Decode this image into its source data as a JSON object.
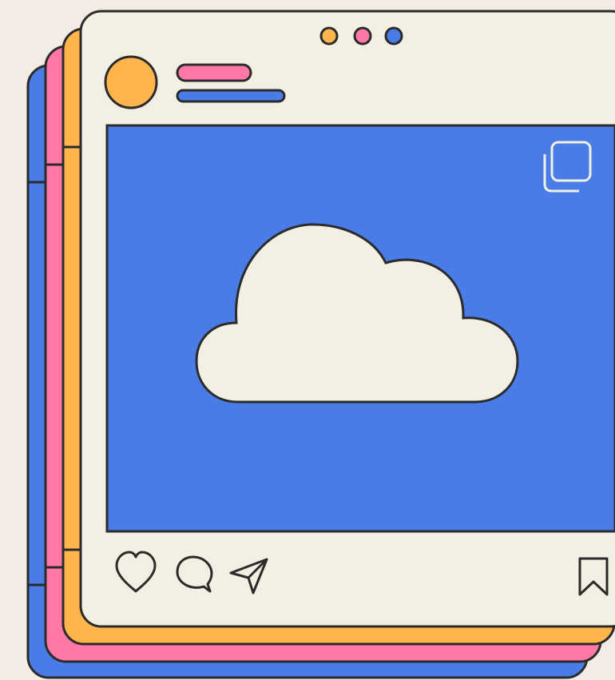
{
  "post": {
    "window_dots": [
      {
        "name": "dot-orange",
        "color": "#FFB54C"
      },
      {
        "name": "dot-pink",
        "color": "#FF78A8"
      },
      {
        "name": "dot-blue",
        "color": "#4A7CE8"
      }
    ],
    "avatar_icon": "avatar-circle",
    "username_placeholder_lines": [
      "pink-line",
      "blue-line"
    ],
    "media": {
      "icon": "cloud-icon",
      "corner_icon": "multiple-images-icon"
    },
    "actions": [
      {
        "name": "like-button",
        "icon": "heart-icon"
      },
      {
        "name": "comment-button",
        "icon": "comment-icon"
      },
      {
        "name": "share-button",
        "icon": "send-icon"
      },
      {
        "name": "save-button",
        "icon": "bookmark-icon"
      }
    ]
  },
  "colors": {
    "background": "#F3EBE4",
    "card": "#F3F0E3",
    "outline": "#2B2B2B",
    "blue": "#4A7CE8",
    "pink": "#FF78A8",
    "orange": "#FFB54C"
  }
}
